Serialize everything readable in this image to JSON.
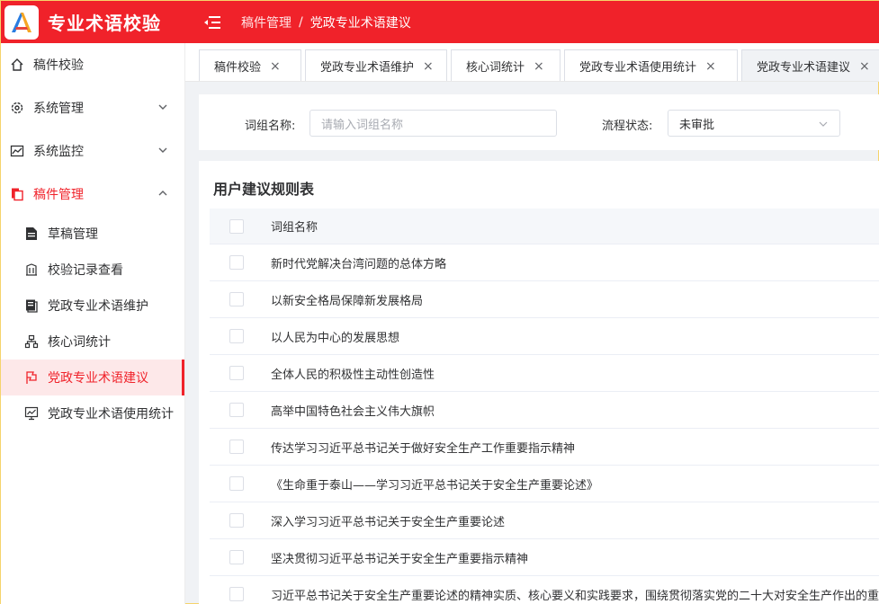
{
  "app": {
    "title": "专业术语校验",
    "logo_letter": "A"
  },
  "breadcrumb": {
    "first": "稿件管理",
    "separator": "/",
    "current": "党政专业术语建议"
  },
  "sidebar": {
    "items": [
      {
        "label": "稿件校验",
        "icon": "home-icon"
      },
      {
        "label": "系统管理",
        "icon": "gear-icon"
      },
      {
        "label": "系统监控",
        "icon": "chart-line-icon"
      },
      {
        "label": "稿件管理",
        "icon": "document-stack-icon"
      }
    ],
    "sub_items": [
      {
        "label": "草稿管理",
        "icon": "draft-icon"
      },
      {
        "label": "校验记录查看",
        "icon": "building-icon"
      },
      {
        "label": "党政专业术语维护",
        "icon": "book-icon"
      },
      {
        "label": "核心词统计",
        "icon": "hierarchy-icon"
      },
      {
        "label": "党政专业术语建议",
        "icon": "flag-icon"
      },
      {
        "label": "党政专业术语使用统计",
        "icon": "monitor-chart-icon"
      }
    ]
  },
  "tabs": [
    {
      "label": "稿件校验",
      "close": "×"
    },
    {
      "label": "党政专业术语维护",
      "close": "×"
    },
    {
      "label": "核心词统计",
      "close": "×"
    },
    {
      "label": "党政专业术语使用统计",
      "close": "×"
    },
    {
      "label": "党政专业术语建议",
      "close": "×"
    }
  ],
  "filter": {
    "name_label": "词组名称:",
    "name_placeholder": "请输入词组名称",
    "status_label": "流程状态:",
    "status_value": "未审批"
  },
  "table": {
    "title": "用户建议规则表",
    "column_header": "词组名称",
    "rows": [
      "新时代党解决台湾问题的总体方略",
      "以新安全格局保障新发展格局",
      "以人民为中心的发展思想",
      "全体人民的积极性主动性创造性",
      "高举中国特色社会主义伟大旗帜",
      "传达学习习近平总书记关于做好安全生产工作重要指示精神",
      "《生命重于泰山——学习习近平总书记关于安全生产重要论述》",
      "深入学习习近平总书记关于安全生产重要论述",
      "坚决贯彻习近平总书记关于安全生产重要指示精神",
      "习近平总书记关于安全生产重要论述的精神实质、核心要义和实践要求，围绕贯彻落实党的二十大对安全生产作出的重"
    ]
  },
  "colors": {
    "brand_red": "#f0222a",
    "active_bg": "#fde8e9"
  }
}
